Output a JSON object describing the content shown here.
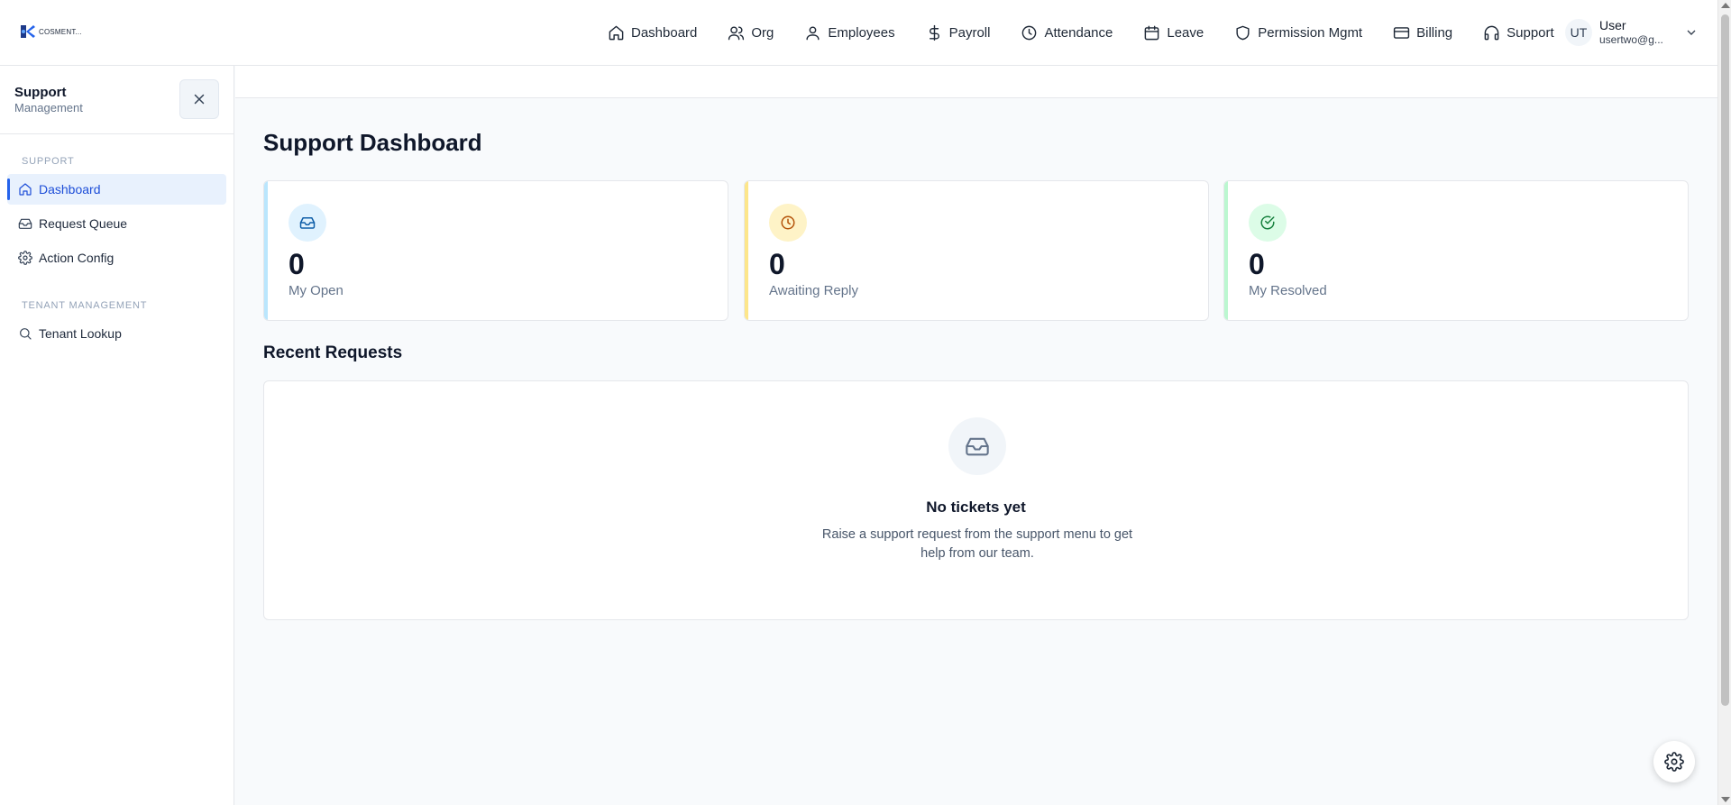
{
  "app": {
    "logo_text": "COSMENT..."
  },
  "nav": {
    "items": [
      {
        "label": "Dashboard",
        "icon": "home-icon"
      },
      {
        "label": "Org",
        "icon": "users-icon"
      },
      {
        "label": "Employees",
        "icon": "user-icon"
      },
      {
        "label": "Payroll",
        "icon": "dollar-icon"
      },
      {
        "label": "Attendance",
        "icon": "clock-icon"
      },
      {
        "label": "Leave",
        "icon": "calendar-icon"
      },
      {
        "label": "Permission Mgmt",
        "icon": "shield-icon"
      },
      {
        "label": "Billing",
        "icon": "credit-card-icon"
      },
      {
        "label": "Support",
        "icon": "headphones-icon"
      }
    ]
  },
  "user": {
    "initials": "UT",
    "name": "User",
    "email": "usertwo@g..."
  },
  "sidebar": {
    "title": "Support",
    "subtitle": "Management",
    "sections": [
      {
        "label": "SUPPORT",
        "items": [
          {
            "label": "Dashboard",
            "icon": "home-icon",
            "active": true
          },
          {
            "label": "Request Queue",
            "icon": "inbox-icon"
          },
          {
            "label": "Action Config",
            "icon": "gear-icon"
          }
        ]
      },
      {
        "label": "TENANT MANAGEMENT",
        "items": [
          {
            "label": "Tenant Lookup",
            "icon": "search-icon"
          }
        ]
      }
    ]
  },
  "main": {
    "title": "Support Dashboard",
    "stats": [
      {
        "value": "0",
        "label": "My Open",
        "icon": "inbox-icon",
        "accent": "#bae6fd",
        "icon_bg": "#e0f2fe",
        "icon_color": "#0f5ea8"
      },
      {
        "value": "0",
        "label": "Awaiting Reply",
        "icon": "clock-icon",
        "accent": "#fde68a",
        "icon_bg": "#fef3c7",
        "icon_color": "#b45309"
      },
      {
        "value": "0",
        "label": "My Resolved",
        "icon": "check-circle-icon",
        "accent": "#bbf7d0",
        "icon_bg": "#dcfce7",
        "icon_color": "#15803d"
      }
    ],
    "recent": {
      "title": "Recent Requests",
      "empty_title": "No tickets yet",
      "empty_text": "Raise a support request from the support menu to get help from our team."
    }
  }
}
